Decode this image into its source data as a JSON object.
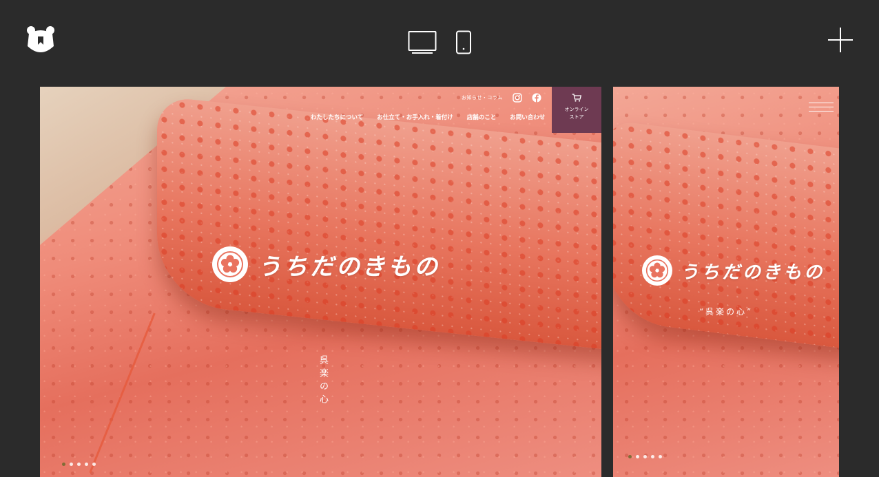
{
  "toolbar": {
    "logo_icon": "bear-bookmark-icon",
    "desktop_icon": "desktop-monitor-icon",
    "mobile_icon": "smartphone-icon",
    "add_icon": "plus-icon"
  },
  "desktop_site": {
    "top_links": {
      "news": "お知らせ・コラム",
      "instagram_icon": "instagram-icon",
      "facebook_icon": "facebook-icon"
    },
    "nav": [
      "わたしたちについて",
      "お仕立て・お手入れ・着付け",
      "店舗のこと",
      "お問い合わせ"
    ],
    "store_button": "オンライン\nストア",
    "brand": "うちだのきもの",
    "tagline": "呉楽の心",
    "slider_dots": 5,
    "active_dot": 0
  },
  "mobile_site": {
    "menu_icon": "hamburger-menu-icon",
    "brand": "うちだのきもの",
    "tagline": "“呉楽の心”",
    "slider_dots": 5,
    "active_dot": 0
  },
  "colors": {
    "background": "#2b2b2b",
    "store_button": "#6e3a52",
    "fabric": "#e56f5d",
    "active_dot": "#6f6a2e"
  }
}
